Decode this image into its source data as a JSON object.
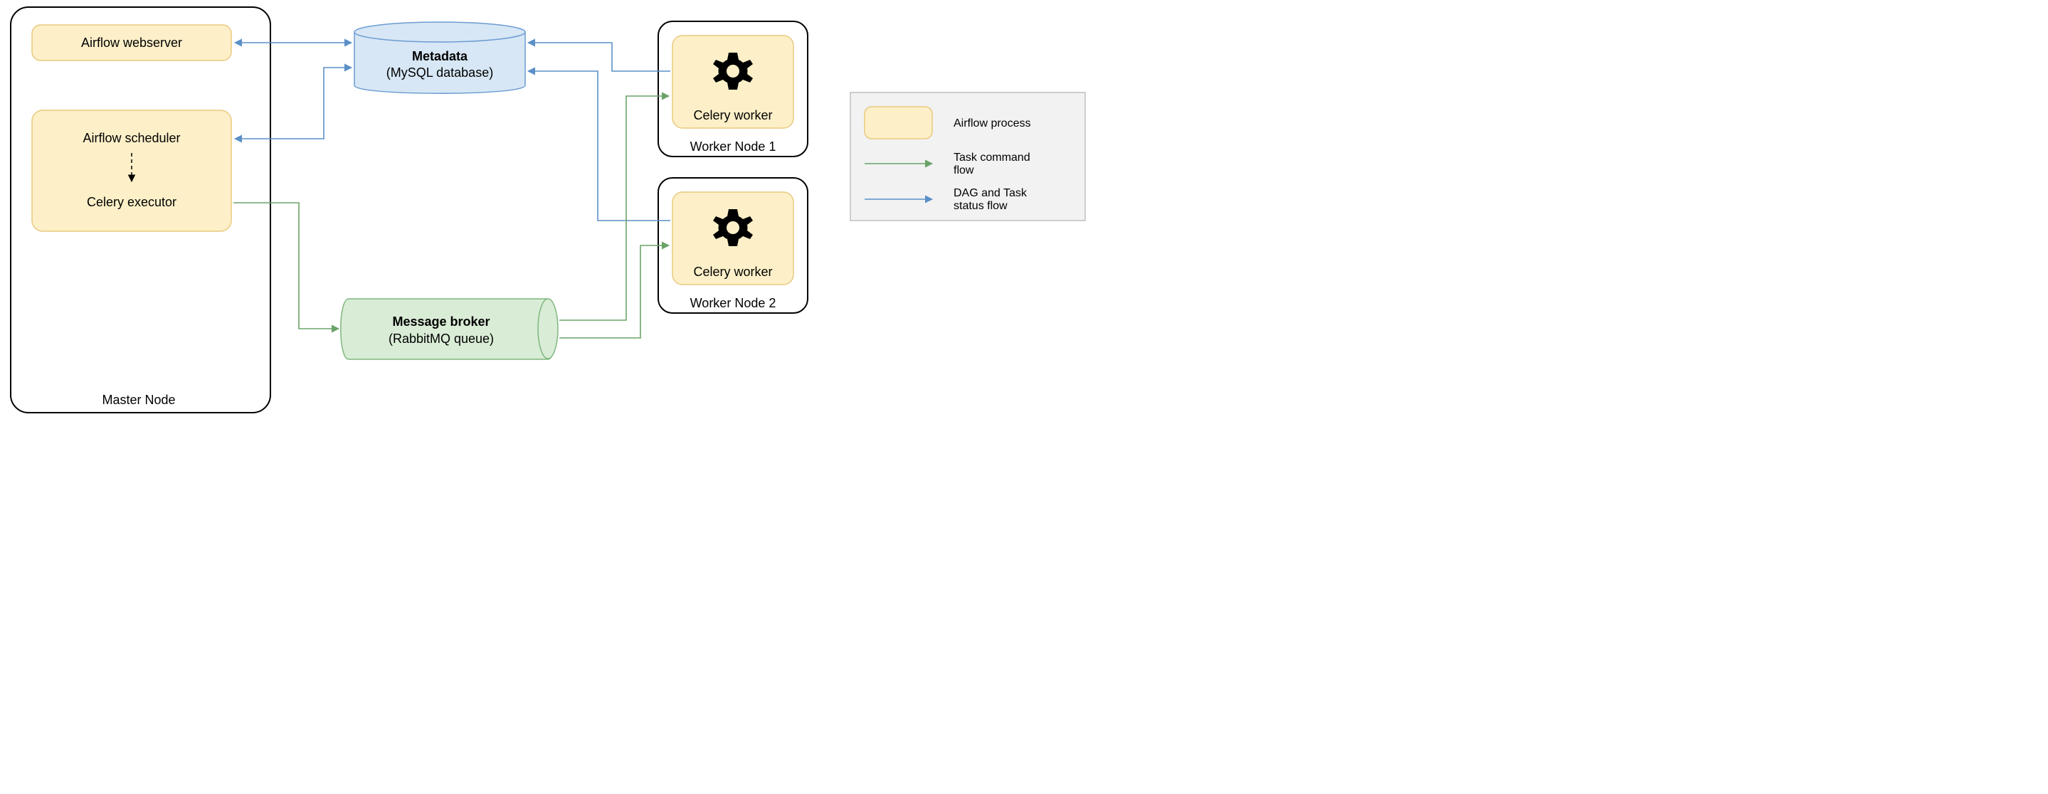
{
  "master": {
    "title": "Master Node",
    "webserver": "Airflow webserver",
    "scheduler": "Airflow scheduler",
    "executor": "Celery executor"
  },
  "metadata": {
    "title": "Metadata",
    "subtitle": "(MySQL database)"
  },
  "broker": {
    "title": "Message broker",
    "subtitle": "(RabbitMQ queue)"
  },
  "worker1": {
    "title": "Worker Node 1",
    "label": "Celery worker"
  },
  "worker2": {
    "title": "Worker Node 2",
    "label": "Celery worker"
  },
  "legend": {
    "process": "Airflow process",
    "task_flow": "Task command flow",
    "status_flow": "DAG and Task status flow"
  },
  "colors": {
    "yellow_fill": "#fdf0c8",
    "yellow_stroke": "#e9c97f",
    "blue_fill": "#d7e7f5",
    "blue_stroke": "#6b9cd1",
    "green_fill": "#d9ecd6",
    "green_stroke": "#7fb77e",
    "arrow_blue": "#5b8fc7",
    "arrow_green": "#6aa368",
    "legend_bg": "#f2f2f2",
    "legend_border": "#bfbfbf"
  }
}
